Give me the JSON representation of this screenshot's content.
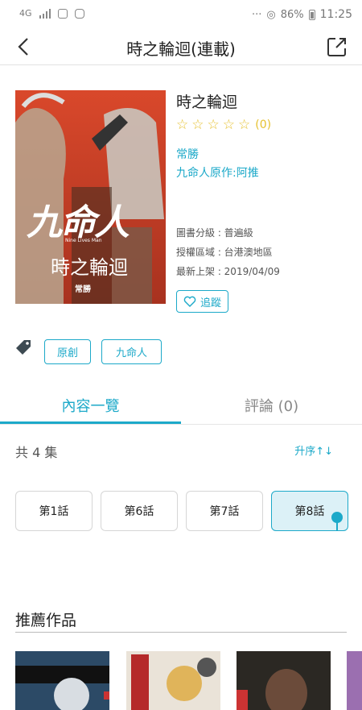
{
  "status_bar": {
    "network": "4G",
    "battery": "86%",
    "time": "11:25",
    "more": "···"
  },
  "header": {
    "title": "時之輪迴(連載)"
  },
  "book": {
    "title": "時之輪迴",
    "rating_count": "(0)",
    "author": "常勝",
    "original": "九命人原作:阿推",
    "grade": "圖書分級 : 普遍級",
    "region": "授權區域 : 台港澳地區",
    "latest": "最新上架 : 2019/04/09",
    "follow_label": "追蹤",
    "cover": {
      "title_big": "九命人",
      "subtitle_en": "Nine Lives Man",
      "title": "時之輪迴",
      "author": "常勝"
    }
  },
  "tags": [
    "原創",
    "九命人"
  ],
  "tabs": {
    "contents": "內容一覽",
    "reviews": "評論 (0)"
  },
  "episodes_info": {
    "total": "共 4 集",
    "sort": "升序↑↓"
  },
  "episodes": [
    {
      "label": "第1話",
      "selected": false
    },
    {
      "label": "第6話",
      "selected": false
    },
    {
      "label": "第7話",
      "selected": false
    },
    {
      "label": "第8話",
      "selected": true
    }
  ],
  "recommend": {
    "heading": "推薦作品"
  },
  "colors": {
    "accent": "#1ca9c9",
    "star": "#e6c12f",
    "cover_bg": "#c0392b"
  }
}
